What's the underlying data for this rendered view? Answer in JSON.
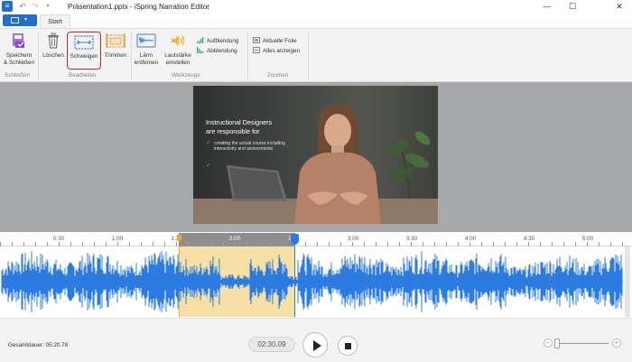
{
  "window": {
    "title": "Präsentation1.pptx - iSpring Narration Editor",
    "minimize_icon": "minimize-icon",
    "maximize_icon": "maximize-icon",
    "close_icon": "close-icon"
  },
  "tabs": {
    "start": "Start"
  },
  "ribbon": {
    "save_close": [
      "Speichern",
      "& Schließen"
    ],
    "delete": "Löschen",
    "silence": "Schweigen",
    "trim": "Trimmen",
    "noise": [
      "Lärm",
      "entfernen"
    ],
    "volume": [
      "Lautstärke",
      "einstellen"
    ],
    "fade_in": "Aufblendung",
    "fade_out": "Abblendung",
    "current_slide": "Aktuelle Folie",
    "show_all": "Alles anzeigen",
    "groups": {
      "close": "Schließen",
      "edit": "Bearbeiten",
      "tools": "Werkzeuge",
      "zoom": "Zoomen"
    }
  },
  "slide": {
    "title": [
      "Instructional Designers",
      "are responsible for"
    ],
    "items": [
      [
        "creating the actual course including",
        "interactivity and assessments"
      ],
      []
    ]
  },
  "timeline": {
    "ticks": [
      "0:30",
      "1:00",
      "1:3",
      "2:00",
      "2:",
      "3:00",
      "3:30",
      "4:00",
      "4:30",
      "5:00"
    ]
  },
  "footer": {
    "total_duration": "Gesamtdauer: 05:20.78",
    "current_time": "02:30.09"
  },
  "colors": {
    "accent": "#1f6fd1",
    "waveform": "#2b7be0",
    "selection": "#f6e0a6",
    "selected_button_border": "#d9261c"
  }
}
